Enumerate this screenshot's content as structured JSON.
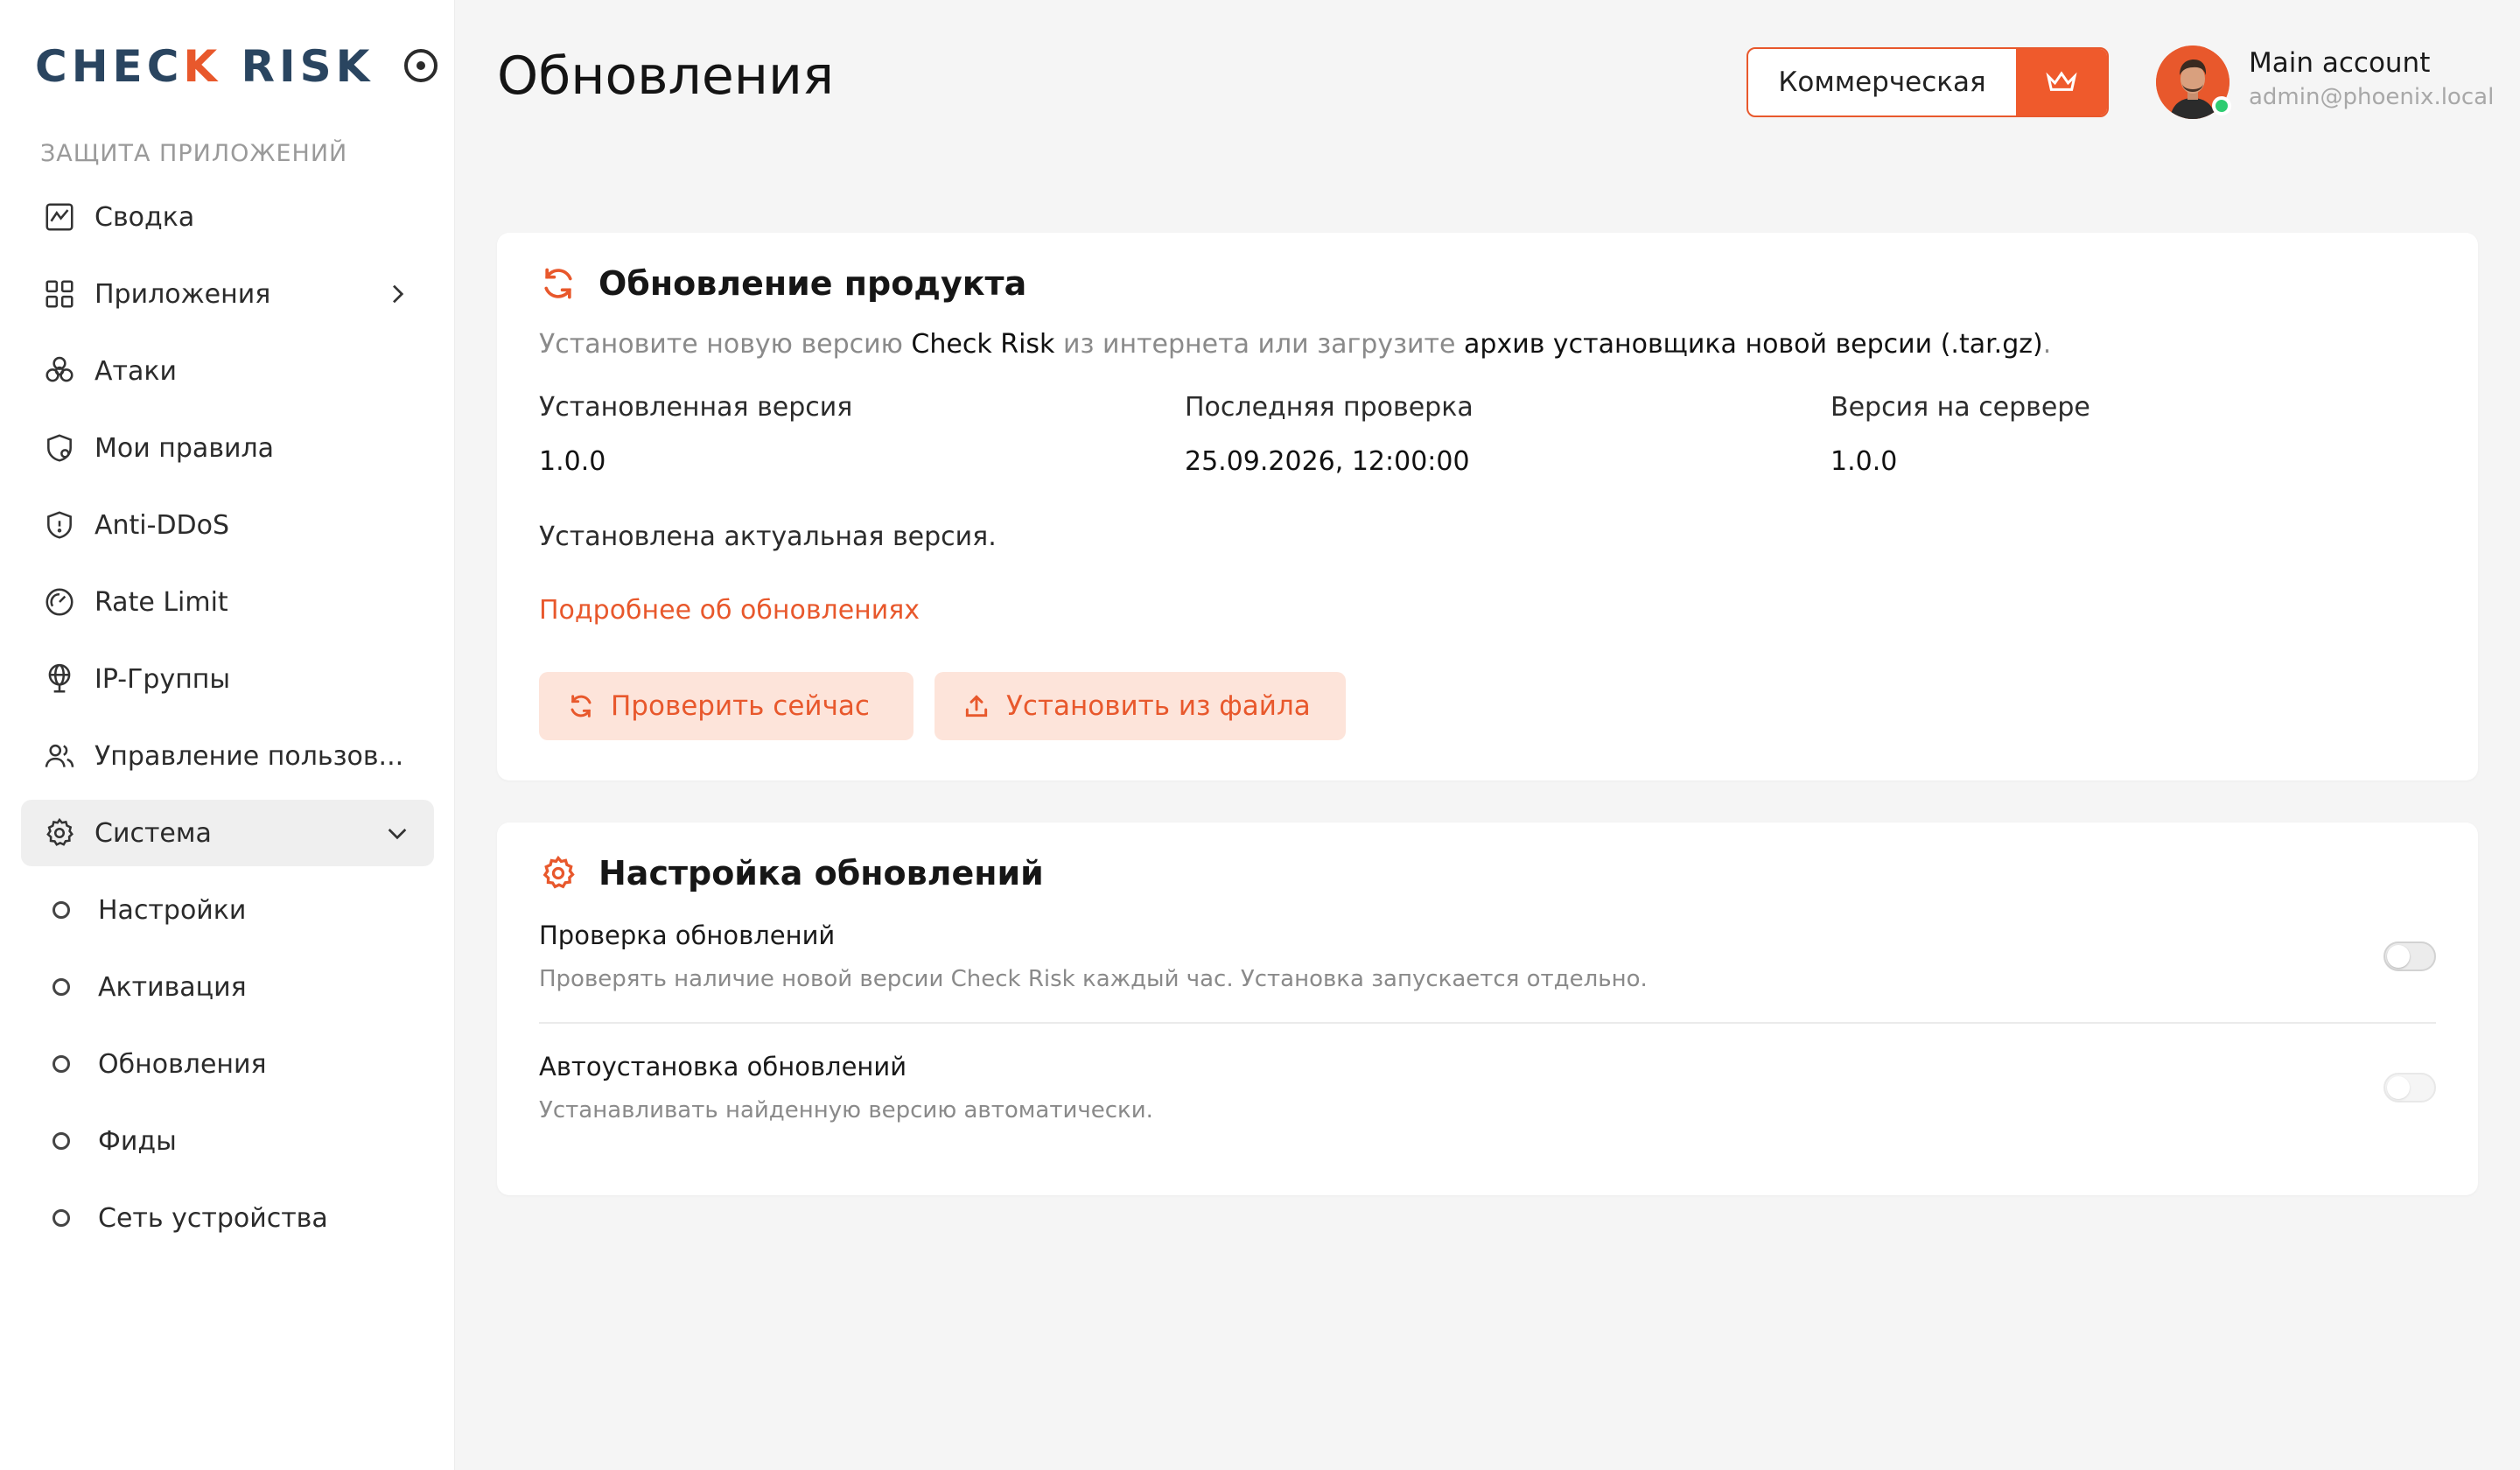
{
  "brand": {
    "logo_left": "CHEC",
    "logo_accent": "K",
    "logo_right": " RISK",
    "accent_color": "#e8582c"
  },
  "sidebar": {
    "section_label": "ЗАЩИТА ПРИЛОЖЕНИЙ",
    "items": [
      {
        "label": "Сводка",
        "icon": "chart-icon"
      },
      {
        "label": "Приложения",
        "icon": "grid-icon"
      },
      {
        "label": "Атаки",
        "icon": "biohazard-icon"
      },
      {
        "label": "Мои правила",
        "icon": "shield-gear-icon"
      },
      {
        "label": "Anti-DDoS",
        "icon": "shield-icon"
      },
      {
        "label": "Rate Limit",
        "icon": "gauge-icon"
      },
      {
        "label": "IP-Группы",
        "icon": "globe-icon"
      },
      {
        "label": "Управление пользов...",
        "icon": "users-icon"
      },
      {
        "label": "Система",
        "icon": "gear-icon"
      }
    ],
    "sub_items": [
      {
        "label": "Настройки"
      },
      {
        "label": "Активация"
      },
      {
        "label": "Обновления"
      },
      {
        "label": "Фиды"
      },
      {
        "label": "Сеть устройства"
      }
    ]
  },
  "header": {
    "title": "Обновления",
    "license_label": "Коммерческая",
    "account_name": "Main account",
    "account_email": "admin@phoenix.local"
  },
  "product_update": {
    "title": "Обновление продукта",
    "desc_1": "Установите новую версию ",
    "desc_2": "Check Risk",
    "desc_3": " из интернета или загрузите ",
    "desc_4": "архив установщика новой версии (.tar.gz)",
    "desc_5": ".",
    "installed_label": "Установленная версия",
    "installed_value": "1.0.0",
    "last_check_label": "Последняя проверка",
    "last_check_value": "25.09.2026, 12:00:00",
    "server_label": "Версия на сервере",
    "server_value": "1.0.0",
    "status": "Установлена актуальная версия.",
    "more_link": "Подробнее об обновлениях",
    "check_button": "Проверить сейчас",
    "install_button": "Установить из файла"
  },
  "update_settings": {
    "title": "Настройка обновлений",
    "check_title": "Проверка обновлений",
    "check_desc": "Проверять наличие новой версии Check Risk каждый час. Установка запускается отдельно.",
    "auto_title": "Автоустановка обновлений",
    "auto_desc": "Устанавливать найденную версию автоматически."
  }
}
